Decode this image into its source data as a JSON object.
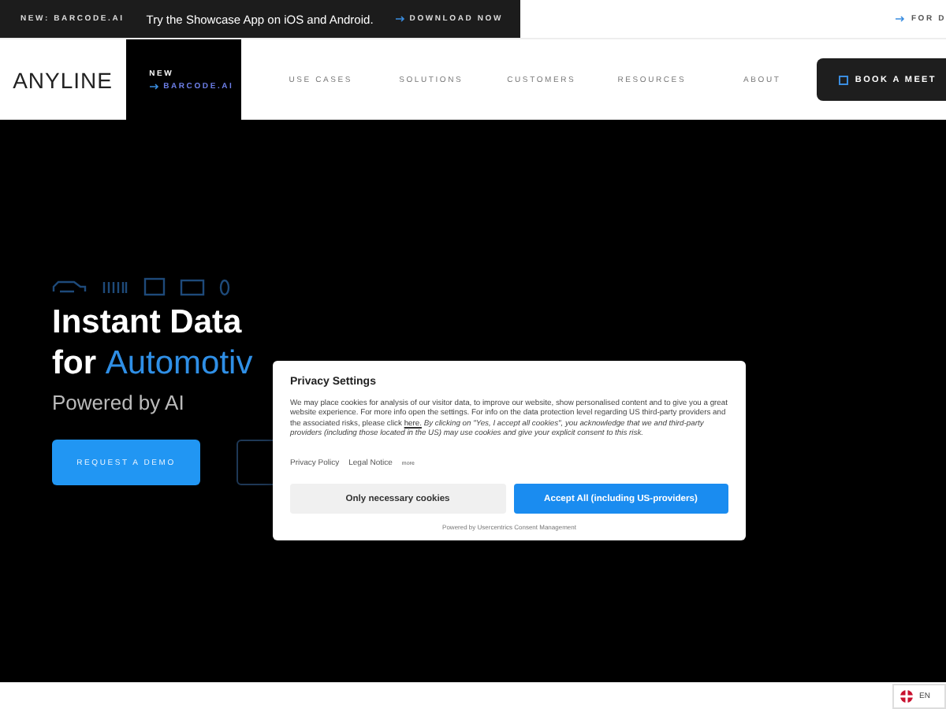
{
  "announcement": {
    "badge": "NEW: BARCODE.AI",
    "text": "Try the Showcase App on iOS and Android.",
    "link": "DOWNLOAD NOW",
    "right_link": "FOR D"
  },
  "nav": {
    "logo": "ANYLINE",
    "promo_small": "NEW",
    "promo_link": "BARCODE.AI",
    "items": [
      {
        "label": "USE CASES"
      },
      {
        "label": "SOLUTIONS"
      },
      {
        "label": "CUSTOMERS"
      },
      {
        "label": "RESOURCES"
      },
      {
        "label": "ABOUT"
      }
    ],
    "cta": "BOOK A MEET"
  },
  "hero": {
    "headline_1": "Instant Data",
    "headline_2_prefix": "for",
    "headline_2_accent": "Automotiv",
    "subtitle": "Powered by AI",
    "primary_button": "REQUEST A DEMO"
  },
  "cookie_dialog": {
    "title": "Privacy Settings",
    "body": "We may place cookies for analysis of our visitor data, to improve our website, show personalised content and to give you a great website experience. For more info open the settings. For info on the data protection level regarding US third-party providers and the associated risks, please click",
    "link": "here.",
    "body_italic": "By clicking on \"Yes, I accept all cookies\", you acknowledge that we and third-party providers (including those located in the US) may use cookies and give your explicit consent to this risk.",
    "links": [
      "Privacy Policy",
      "Legal Notice",
      "more"
    ],
    "buttons": [
      {
        "label": "Only necessary cookies",
        "kind": "secondary"
      },
      {
        "label": "Accept All (including US-providers)",
        "kind": "primary"
      }
    ],
    "footer": "Powered by Usercentrics Consent Management"
  },
  "language": "EN"
}
